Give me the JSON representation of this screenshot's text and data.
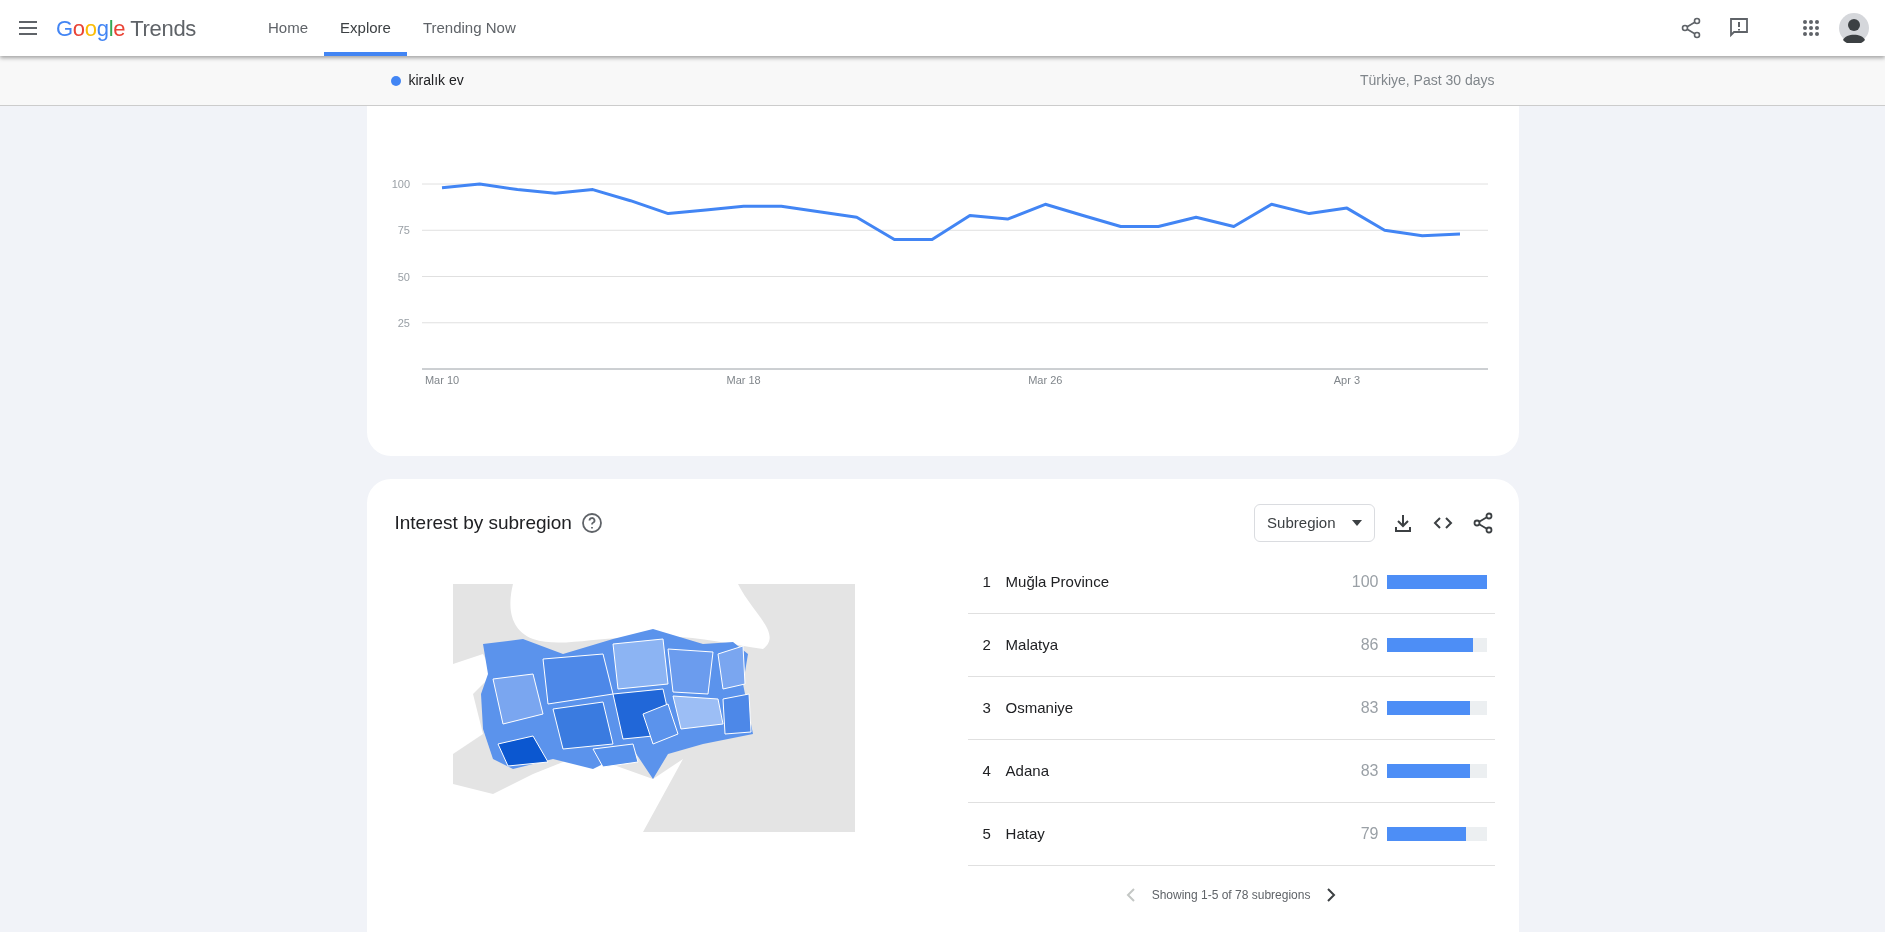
{
  "header": {
    "logo": {
      "brand": "Google",
      "product": "Trends"
    },
    "tabs": [
      {
        "label": "Home",
        "selected": false
      },
      {
        "label": "Explore",
        "selected": true
      },
      {
        "label": "Trending Now",
        "selected": false
      }
    ]
  },
  "query_bar": {
    "term": "kiralık ev",
    "color": "#4285f4",
    "scope": "Türkiye, Past 30 days"
  },
  "interest_over_time": {
    "chart_data": {
      "type": "line",
      "grid": true,
      "categories": [
        "Mar 10",
        null,
        null,
        null,
        null,
        null,
        null,
        null,
        "Mar 18",
        null,
        null,
        null,
        null,
        null,
        null,
        null,
        "Mar 26",
        null,
        null,
        null,
        null,
        null,
        null,
        null,
        "Apr 3",
        null,
        null,
        null
      ],
      "series": [
        {
          "color": "#4285f4",
          "values": [
            98,
            100,
            97,
            95,
            97,
            91,
            84,
            86,
            88,
            88,
            85,
            82,
            70,
            70,
            83,
            81,
            89,
            83,
            77,
            77,
            82,
            77,
            89,
            84,
            87,
            75,
            72,
            73
          ]
        }
      ],
      "ylim": [
        0,
        100
      ],
      "yticks": [
        25,
        50,
        75,
        100
      ]
    }
  },
  "interest_by_subregion": {
    "title": "Interest by subregion",
    "dropdown": "Subregion",
    "rows": [
      {
        "rank": "1",
        "name": "Muğla Province",
        "value": "100",
        "level": 1.0
      },
      {
        "rank": "2",
        "name": "Malatya",
        "value": "86",
        "level": 0.86
      },
      {
        "rank": "3",
        "name": "Osmaniye",
        "value": "83",
        "level": 0.83
      },
      {
        "rank": "4",
        "name": "Adana",
        "value": "83",
        "level": 0.83
      },
      {
        "rank": "5",
        "name": "Hatay",
        "value": "79",
        "level": 0.79
      }
    ],
    "pagination": "Showing 1-5 of 78 subregions"
  }
}
